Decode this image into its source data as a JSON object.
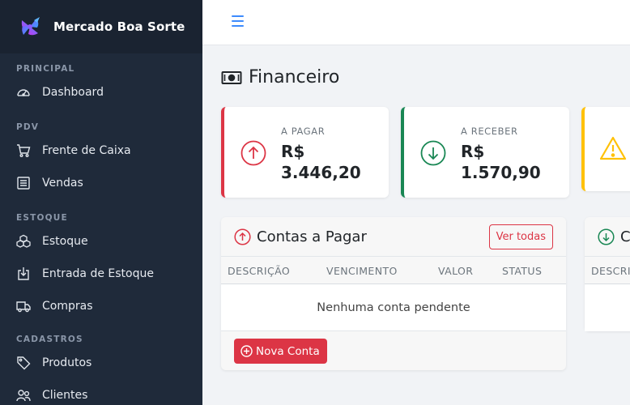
{
  "sidebar": {
    "brand": "Mercado Boa Sorte",
    "sections": {
      "principal": "PRINCIPAL",
      "pdv": "PDV",
      "estoque": "ESTOQUE",
      "cadastros": "CADASTROS"
    },
    "items": {
      "dashboard": "Dashboard",
      "frente_caixa": "Frente de Caixa",
      "vendas": "Vendas",
      "estoque": "Estoque",
      "entrada_estoque": "Entrada de Estoque",
      "compras": "Compras",
      "produtos": "Produtos",
      "clientes": "Clientes"
    },
    "icons": [
      "dashboard-icon",
      "cart-icon",
      "list-icon",
      "boxes-icon",
      "box-arrow-in-icon",
      "truck-icon",
      "tag-icon",
      "people-icon"
    ]
  },
  "header": {
    "menu_icon": "hamburger-icon"
  },
  "page": {
    "title": "Financeiro",
    "title_icon": "cash-icon"
  },
  "stats": {
    "pagar": {
      "label": "A PAGAR",
      "value": "R$ 3.446,20",
      "color": "#dc3545"
    },
    "receber": {
      "label": "A RECEBER",
      "value": "R$ 1.570,90",
      "color": "#198754"
    },
    "alerta": {
      "color": "#ffc107",
      "icon": "warning-icon"
    }
  },
  "contas_pagar": {
    "title": "Contas a Pagar",
    "view_all": "Ver todas",
    "columns": [
      "DESCRIÇÃO",
      "VENCIMENTO",
      "VALOR",
      "STATUS"
    ],
    "empty": "Nenhuma conta pendente",
    "new_button": "Nova Conta"
  },
  "contas_receber": {
    "title_partial": "C",
    "column_partial": "DESCRI"
  }
}
